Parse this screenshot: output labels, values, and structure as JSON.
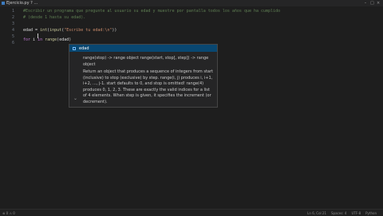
{
  "tab": {
    "title": "Ejercicio.py ?  …",
    "icon": "python-file-icon"
  },
  "window_controls": {
    "min": "–",
    "max": "□",
    "close": "×"
  },
  "gutter": [
    "1",
    "2",
    "3",
    "4",
    "5",
    "6"
  ],
  "code": {
    "line1": "#Escribir un programa que pregunte al usuario su edad y muestre por pantalla todos los años que ha cumplido",
    "line2": "# (desde 1 hasta su edad).",
    "line4_var": "edad",
    "line4_eq": " = ",
    "line4_int": "int",
    "line4_open": "(",
    "line4_input": "input",
    "line4_open2": "(",
    "line4_str": "\"Escribe tu edad:\\n\"",
    "line4_close": "))",
    "line6_for": "for",
    "line6_i": " i ",
    "line6_in": "in",
    "line6_space": " ",
    "line6_range": "range",
    "line6_open": "(",
    "line6_arg": "edad",
    "line6_close": ")"
  },
  "tooltip": {
    "icon": "method-icon",
    "title": "edad",
    "signature": "range(stop) -> range object range(start, stop[, step]) -> range object",
    "doc": "Return an object that produces a sequence of integers from start (inclusive) to stop (exclusive) by step. range(i, j) produces i, i+1, i+2, ..., j-1. start defaults to 0, and stop is omitted! range(4) produces 0, 1, 2, 3. These are exactly the valid indices for a list of 4 elements. When step is given, it specifies the increment (or decrement).",
    "collapse": "⌄"
  },
  "status": {
    "left1": "⊗ 0  ⚠ 0",
    "right1": "Ln 6, Col 21",
    "right2": "Spaces: 4",
    "right3": "UTF-8",
    "right4": "Python"
  }
}
